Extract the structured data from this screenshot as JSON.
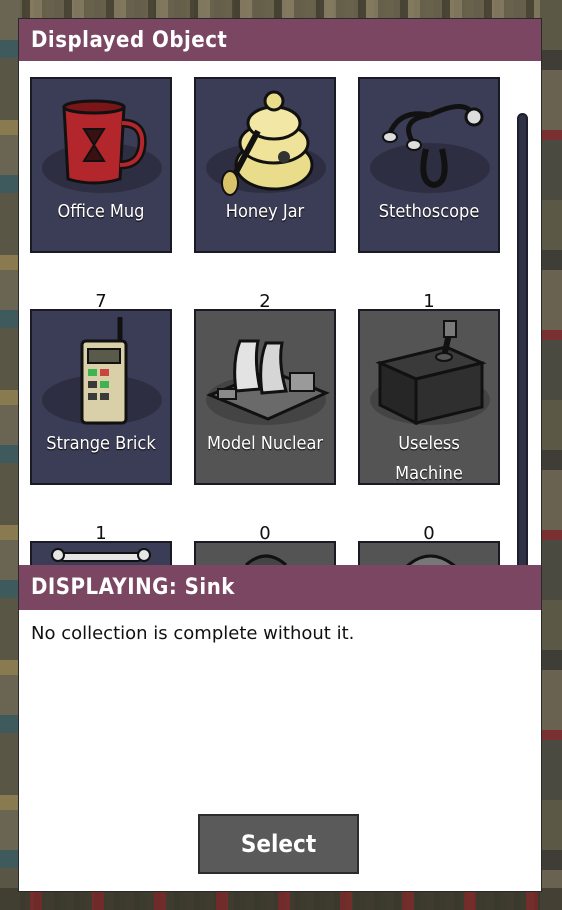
{
  "panel_title": "Displayed Object",
  "items": [
    {
      "label": "Office Mug",
      "count": "7",
      "icon": "mug-icon",
      "locked": false
    },
    {
      "label": "Honey Jar",
      "count": "2",
      "icon": "honey-jar-icon",
      "locked": false
    },
    {
      "label": "Stethoscope",
      "count": "1",
      "icon": "stethoscope-icon",
      "locked": false
    },
    {
      "label": "Strange Brick",
      "count": "1",
      "icon": "phone-brick-icon",
      "locked": false
    },
    {
      "label": "Model Nuclear",
      "count": "0",
      "icon": "nuclear-model-icon",
      "locked": true
    },
    {
      "label": "Useless Machine",
      "count": "0",
      "icon": "box-machine-icon",
      "locked": true
    }
  ],
  "displaying": {
    "title": "DISPLAYING: Sink",
    "description": "No collection is complete without it."
  },
  "select_button": "Select",
  "colors": {
    "header": "#7a4662",
    "tile": "#3b3c55",
    "tile_locked": "#545454",
    "button": "#5a5a5a"
  }
}
